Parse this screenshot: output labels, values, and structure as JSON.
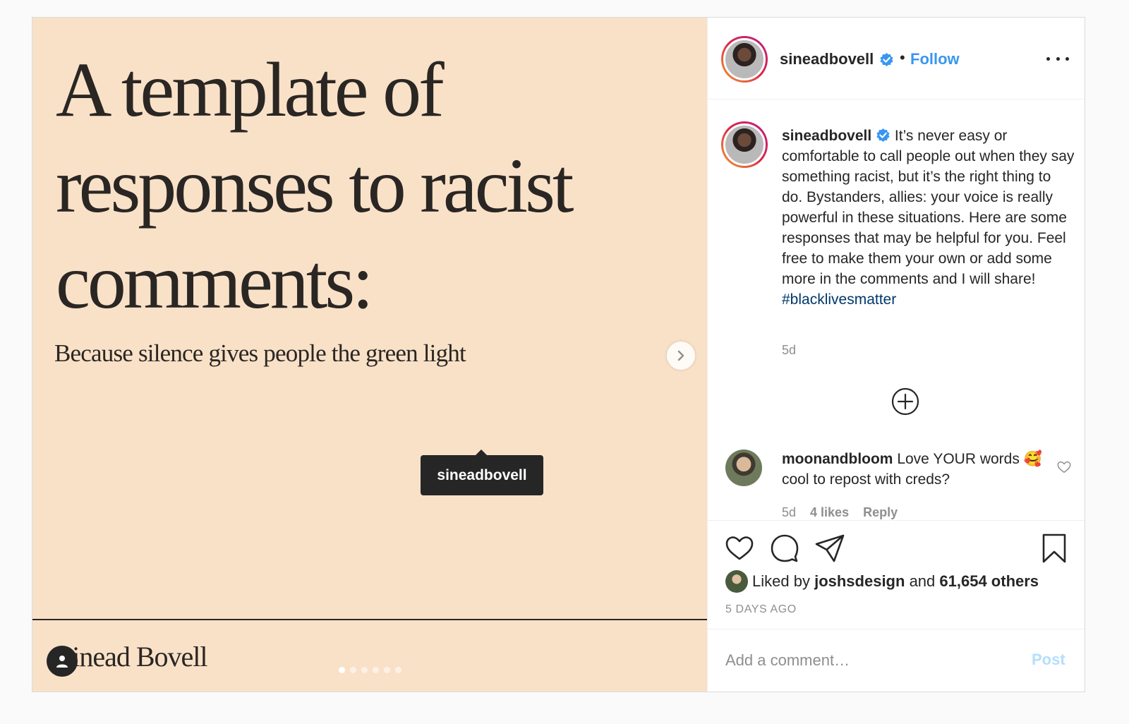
{
  "slide": {
    "title": "A template of responses to racist comments:",
    "subtitle": "Because silence gives people the green light",
    "author": "Sinead Bovell",
    "tag_label": "sineadbovell",
    "dots_total": 6,
    "dots_active": 1
  },
  "header": {
    "username": "sineadbovell",
    "bullet": "•",
    "follow_label": "Follow"
  },
  "caption": {
    "username": "sineadbovell",
    "text": "It’s never easy or comfortable to call people out when they say something racist, but it’s the right thing to do. Bystanders, allies: your voice is really powerful in these situations. Here are some responses that may be helpful for you. Feel free to make them your own or add some more in the comments and I will share!",
    "hashtag": "#blacklivesmatter",
    "time": "5d"
  },
  "reply": {
    "username": "moonandbloom",
    "text": "Love YOUR words 🥰 cool to repost with creds?",
    "time": "5d",
    "likes": "4 likes",
    "reply_label": "Reply"
  },
  "likes": {
    "prefix": "Liked by",
    "user": "joshsdesign",
    "mid": "and",
    "others": "61,654 others"
  },
  "time_ago": "5 DAYS AGO",
  "comment_box": {
    "placeholder": "Add a comment…",
    "post_label": "Post"
  },
  "colors": {
    "slide_bg": "#f9e1c8",
    "link_blue": "#3897f0",
    "hashtag": "#00376b",
    "post_disabled": "#b2dffc"
  }
}
